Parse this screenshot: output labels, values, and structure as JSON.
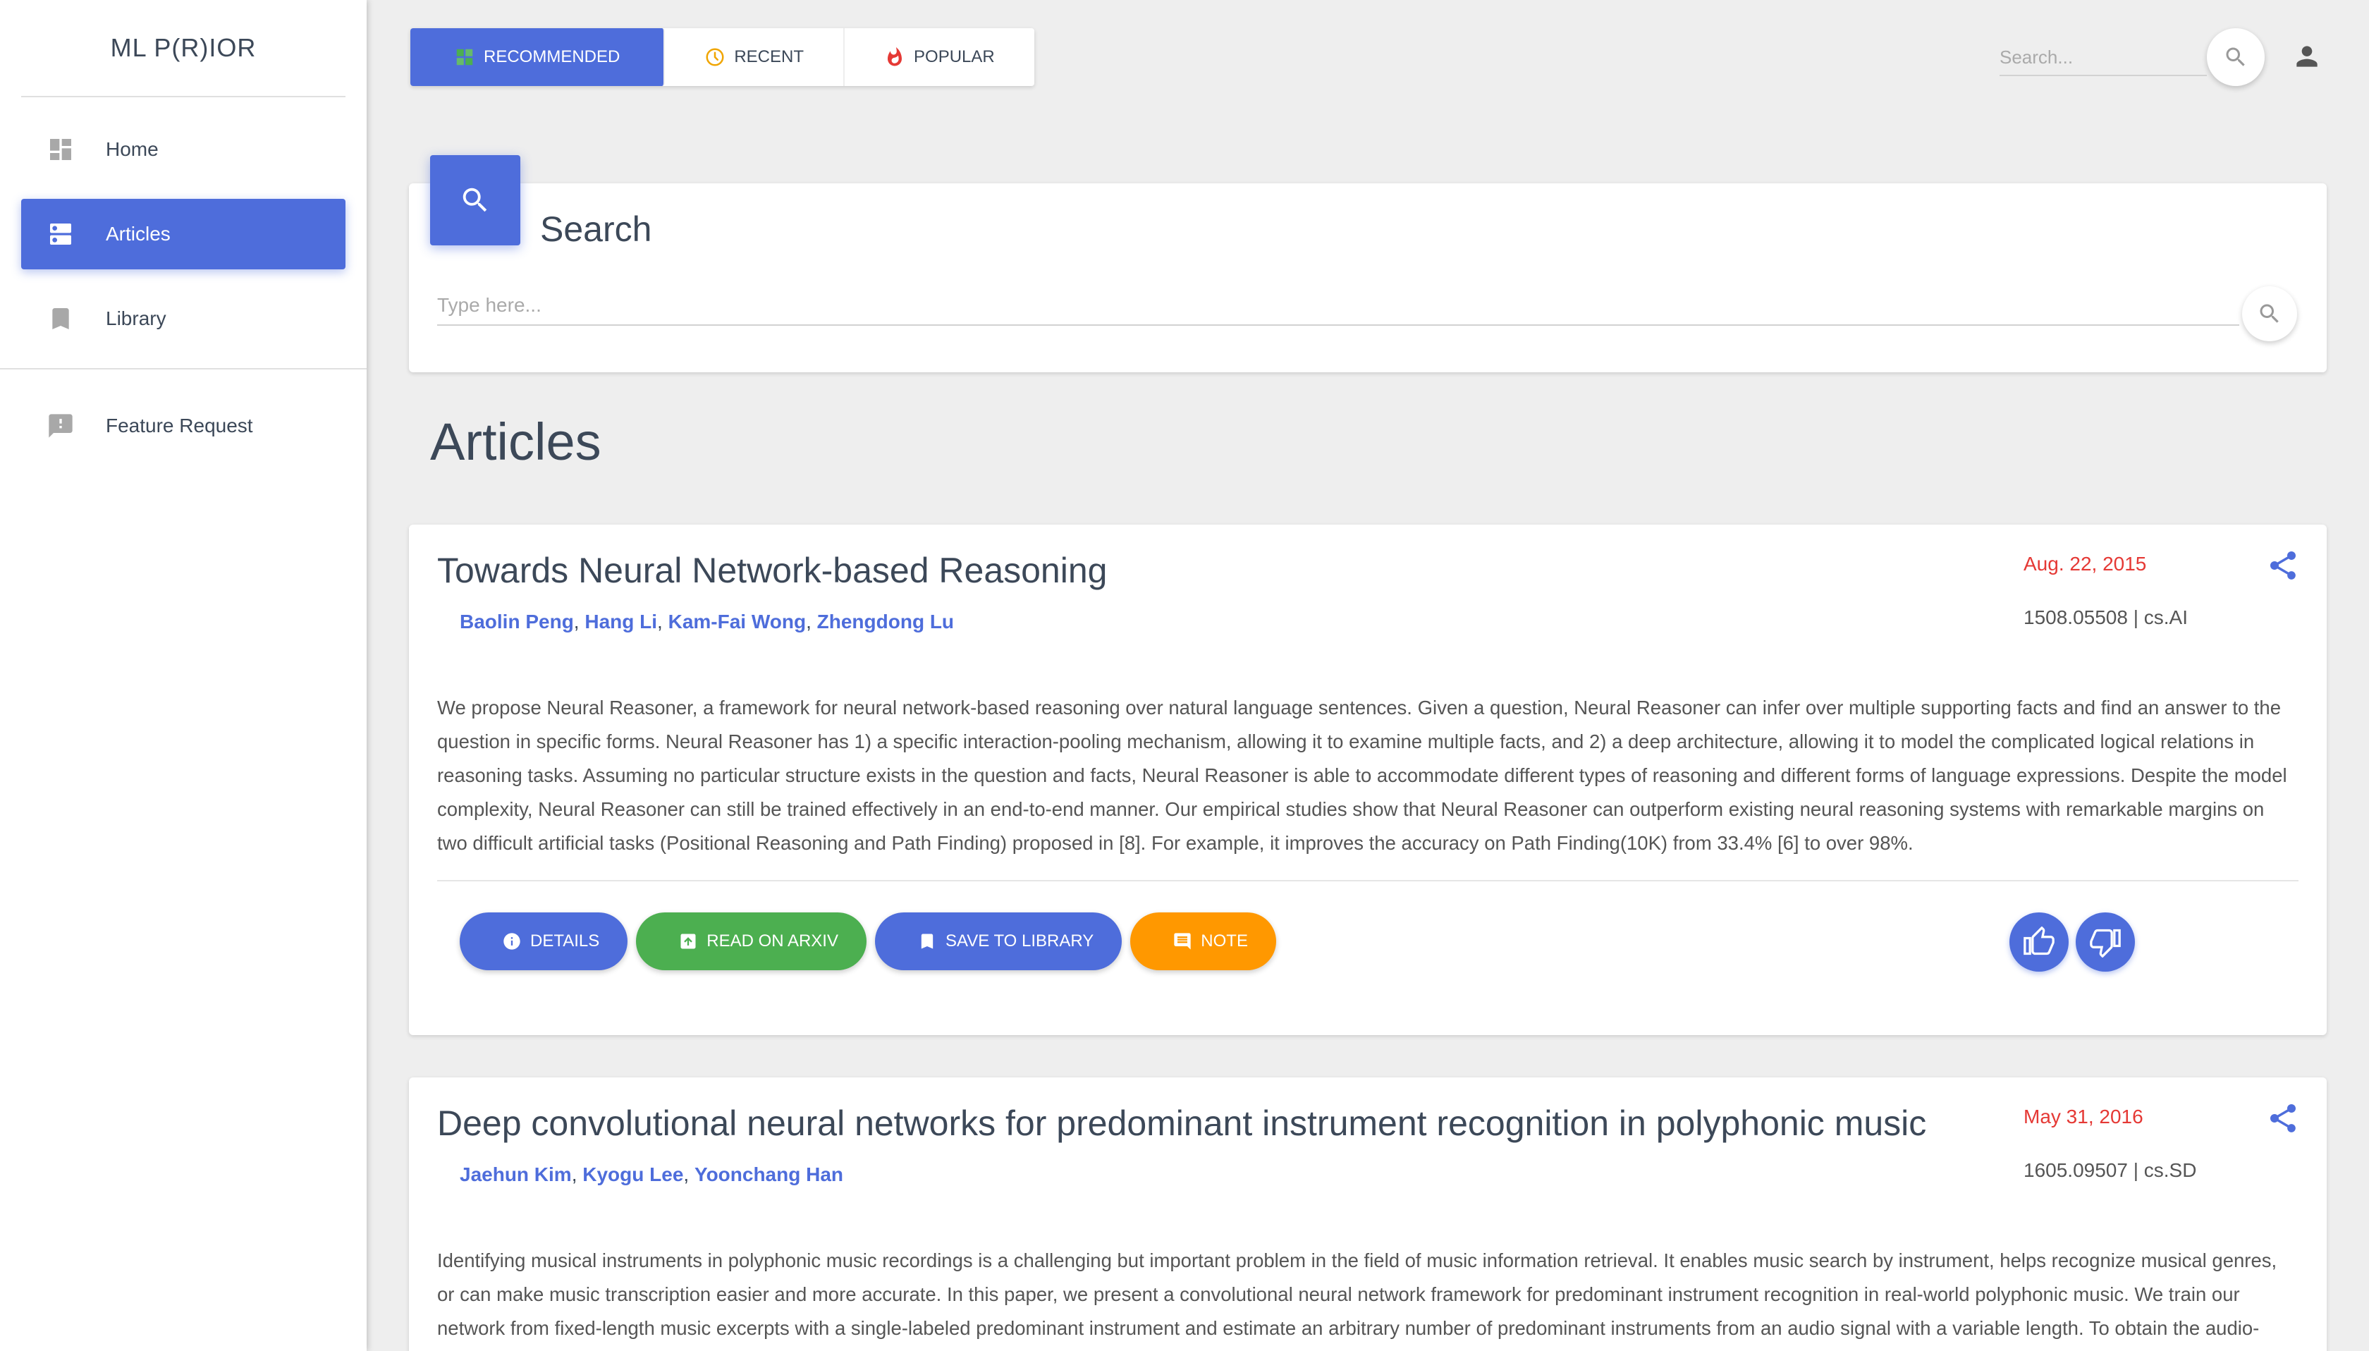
{
  "app": {
    "brand": "ML P(R)IOR"
  },
  "sidebar": {
    "items": [
      {
        "label": "Home",
        "icon": "dashboard-icon",
        "active": false
      },
      {
        "label": "Articles",
        "icon": "articles-icon",
        "active": true
      },
      {
        "label": "Library",
        "icon": "bookmark-icon",
        "active": false
      },
      {
        "label": "Feature Request",
        "icon": "feedback-icon",
        "active": false
      }
    ]
  },
  "tabs": [
    {
      "label": "RECOMMENDED",
      "icon": "grid-icon",
      "active": true
    },
    {
      "label": "RECENT",
      "icon": "clock-icon",
      "active": false
    },
    {
      "label": "POPULAR",
      "icon": "flame-icon",
      "active": false
    }
  ],
  "header": {
    "search_placeholder": "Search..."
  },
  "search_card": {
    "title": "Search",
    "placeholder": "Type here..."
  },
  "articles_section": {
    "title": "Articles"
  },
  "articles": [
    {
      "title": "Towards Neural Network-based Reasoning",
      "authors": [
        "Baolin Peng",
        "Hang Li",
        "Kam-Fai Wong",
        "Zhengdong Lu"
      ],
      "date": "Aug. 22, 2015",
      "meta": "1508.05508 | cs.AI",
      "abstract": "We propose Neural Reasoner, a framework for neural network-based reasoning over natural language sentences. Given a question, Neural Reasoner can infer over multiple supporting facts and find an answer to the question in specific forms. Neural Reasoner has 1) a specific interaction-pooling mechanism, allowing it to examine multiple facts, and 2) a deep architecture, allowing it to model the complicated logical relations in reasoning tasks. Assuming no particular structure exists in the question and facts, Neural Reasoner is able to accommodate different types of reasoning and different forms of language expressions. Despite the model complexity, Neural Reasoner can still be trained effectively in an end-to-end manner. Our empirical studies show that Neural Reasoner can outperform existing neural reasoning systems with remarkable margins on two difficult artificial tasks (Positional Reasoning and Path Finding) proposed in [8]. For example, it improves the accuracy on Path Finding(10K) from 33.4% [6] to over 98%."
    },
    {
      "title": "Deep convolutional neural networks for predominant instrument recognition in polyphonic music",
      "authors": [
        "Jaehun Kim",
        "Kyogu Lee",
        "Yoonchang Han"
      ],
      "date": "May 31, 2016",
      "meta": "1605.09507 | cs.SD",
      "abstract": "Identifying musical instruments in polyphonic music recordings is a challenging but important problem in the field of music information retrieval. It enables music search by instrument, helps recognize musical genres, or can make music transcription easier and more accurate. In this paper, we present a convolutional neural network framework for predominant instrument recognition in real-world polyphonic music. We train our network from fixed-length music excerpts with a single-labeled predominant instrument and estimate an arbitrary number of predominant instruments from an audio signal with a variable length. To obtain the audio-"
    }
  ],
  "actions": {
    "details": "DETAILS",
    "arxiv": "READ ON ARXIV",
    "save": "SAVE TO LIBRARY",
    "note": "NOTE"
  },
  "colors": {
    "primary": "#4e6ddb",
    "success": "#4caf50",
    "warning": "#ff9800",
    "date": "#e53935"
  }
}
